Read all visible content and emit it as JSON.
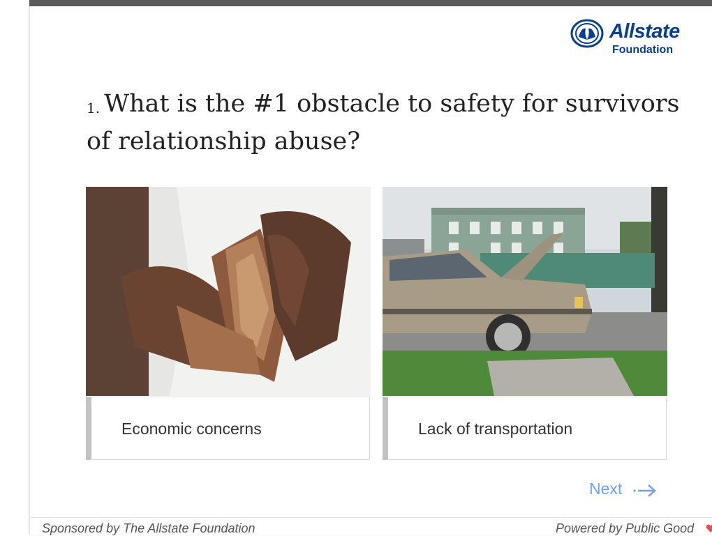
{
  "logo": {
    "brand": "Allstate",
    "sub": "Foundation"
  },
  "question": {
    "number": "1.",
    "text": "What is the #1 obstacle to safety for survivors of relationship abuse?"
  },
  "options": [
    {
      "label": "Economic concerns",
      "image": "empty-wallet-photo"
    },
    {
      "label": "Lack of transportation",
      "image": "broken-down-car-photo"
    }
  ],
  "navigation": {
    "next_label": "Next"
  },
  "footer": {
    "sponsor": "Sponsored by The Allstate Foundation",
    "powered": "Powered by Public Good"
  },
  "colors": {
    "brand": "#0a3e8f",
    "link": "#6ea3ec",
    "topbar": "#5a5a5a"
  }
}
